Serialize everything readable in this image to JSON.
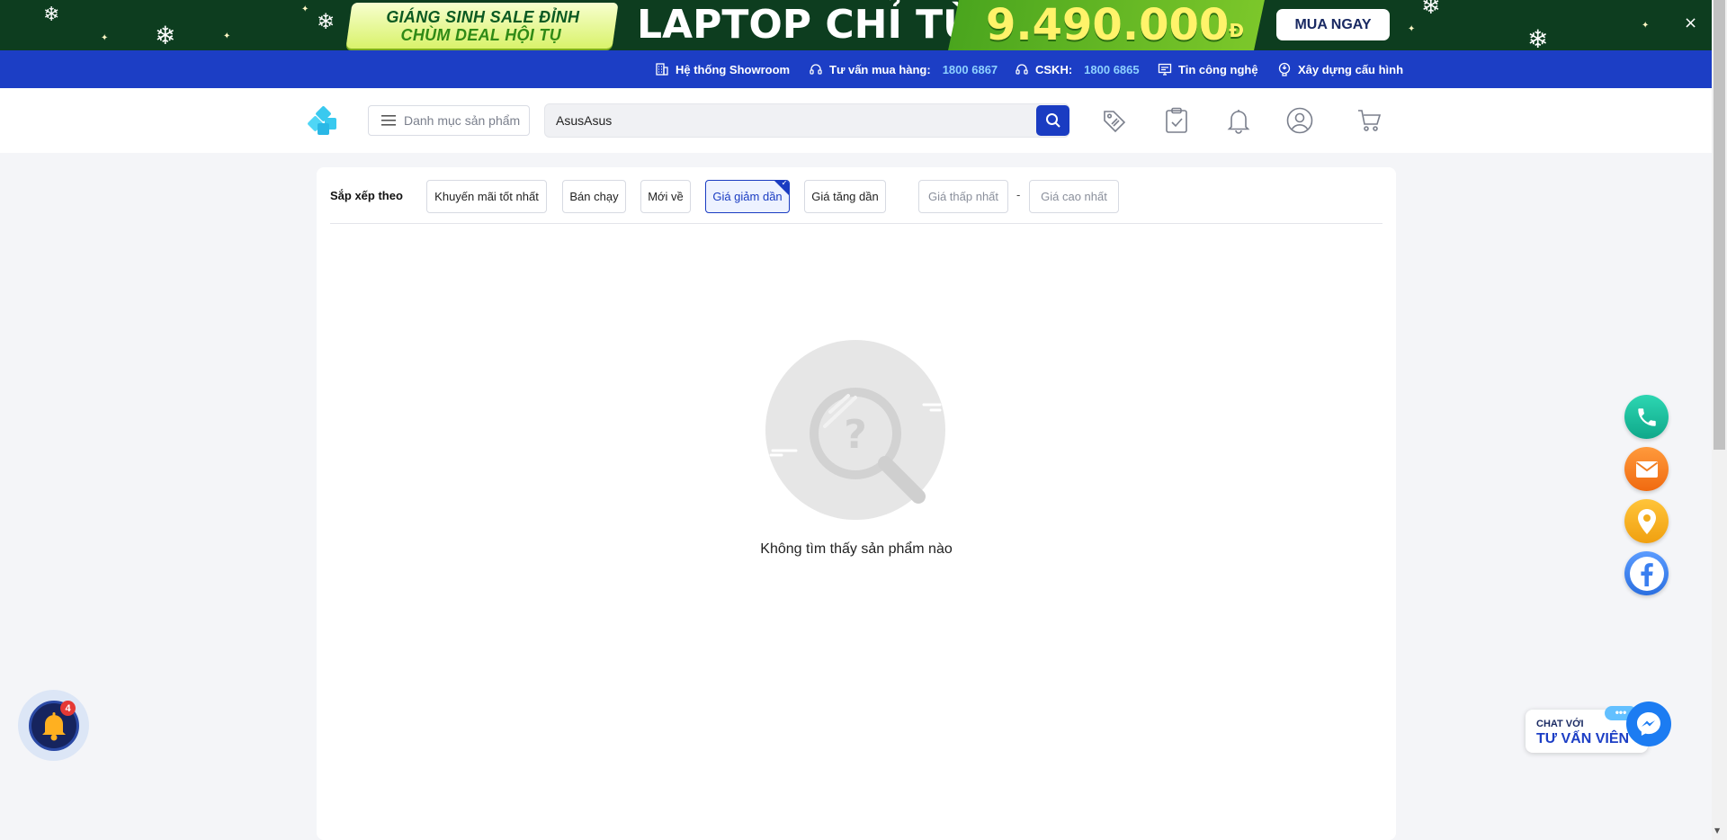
{
  "promo": {
    "tag_line1": "GIÁNG SINH SALE ĐỈNH",
    "tag_line2": "CHÙM DEAL HỘI TỤ",
    "headline": "LAPTOP CHỈ TỪ",
    "price": "9.490.000",
    "currency": "Đ",
    "button": "MUA NGAY",
    "close": "×"
  },
  "infobar": {
    "showroom": "Hệ thống Showroom",
    "consult_label": "Tư vấn mua hàng:",
    "consult_phone": "1800 6867",
    "cskh_label": "CSKH:",
    "cskh_phone": "1800 6865",
    "tech_news": "Tin công nghệ",
    "build_pc": "Xây dựng cấu hình"
  },
  "header": {
    "category_button": "Danh mục sản phẩm",
    "search_value": "AsusAsus"
  },
  "sort": {
    "label": "Sắp xếp theo",
    "options": [
      "Khuyến mãi tốt nhất",
      "Bán chạy",
      "Mới về",
      "Giá giảm dần",
      "Giá tăng dần"
    ],
    "active": "Giá giảm dần",
    "min_price_placeholder": "Giá thấp nhất",
    "separator": "-",
    "max_price_placeholder": "Giá cao nhất"
  },
  "empty": {
    "message": "Không tìm thấy sản phẩm nào"
  },
  "notification": {
    "badge_count": "4"
  },
  "chat": {
    "small": "CHAT VỚI",
    "big": "TƯ VẤN VIÊN",
    "dots": "•••"
  },
  "colors": {
    "brand_blue": "#1c3ec5",
    "promo_green": "#0d3d1f",
    "price_yellow": "#fff36a"
  }
}
